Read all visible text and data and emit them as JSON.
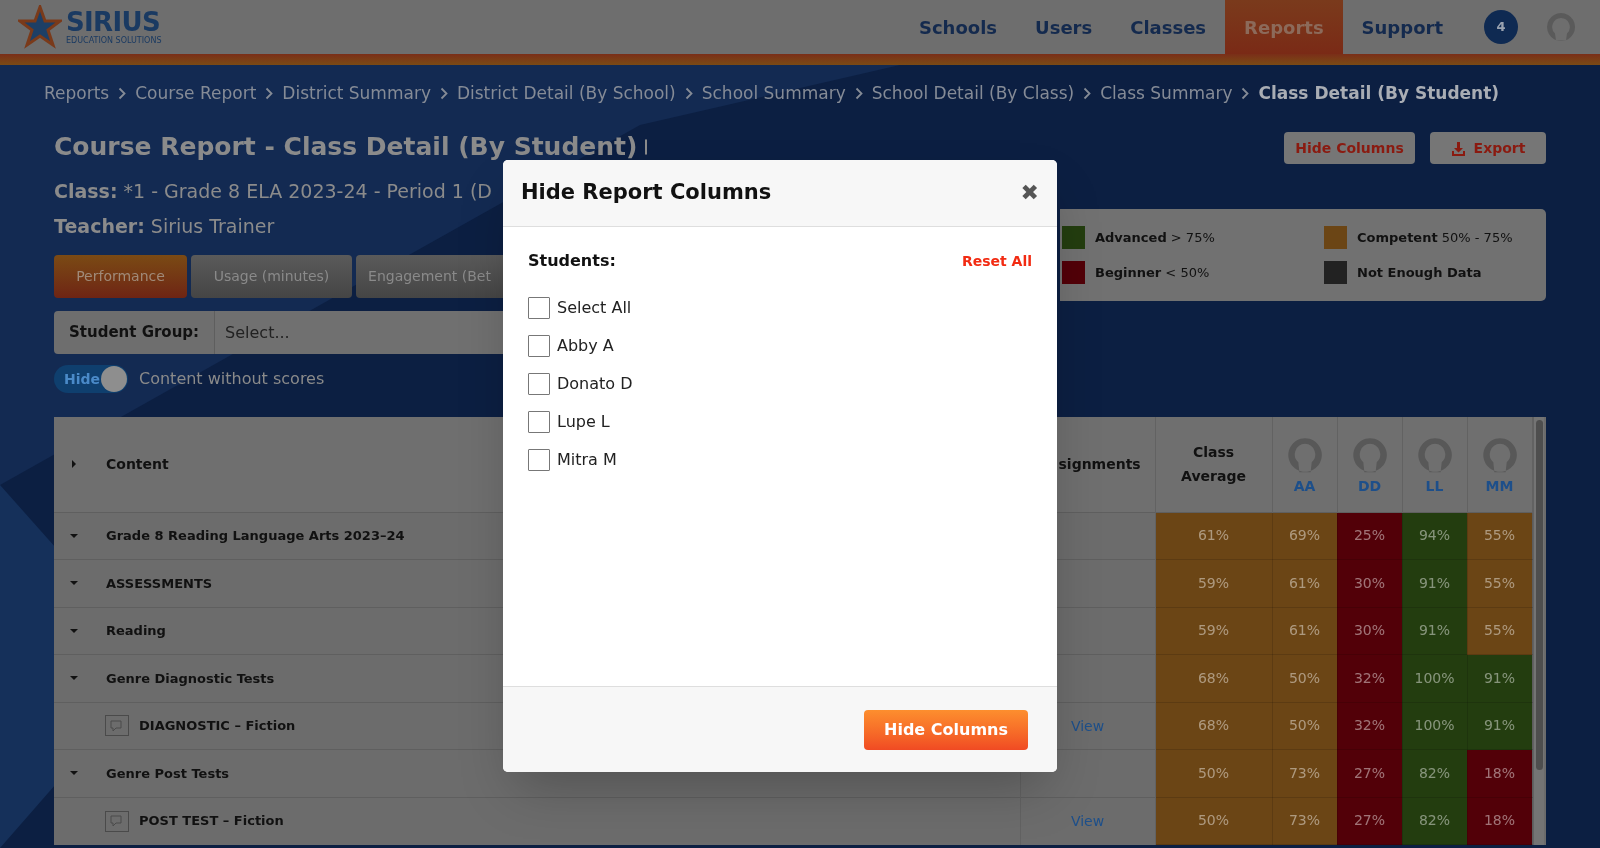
{
  "header": {
    "logo": {
      "name": "SIRIUS",
      "tagline": "EDUCATION SOLUTIONS"
    },
    "nav": [
      {
        "label": "Schools",
        "selected": false
      },
      {
        "label": "Users",
        "selected": false
      },
      {
        "label": "Classes",
        "selected": false
      },
      {
        "label": "Reports",
        "selected": true
      },
      {
        "label": "Support",
        "selected": false
      }
    ],
    "notification_count": "4"
  },
  "breadcrumb": [
    {
      "label": "Reports",
      "current": false
    },
    {
      "label": "Course Report",
      "current": false
    },
    {
      "label": "District Summary",
      "current": false
    },
    {
      "label": "District Detail (By School)",
      "current": false
    },
    {
      "label": "School Summary",
      "current": false
    },
    {
      "label": "School Detail (By Class)",
      "current": false
    },
    {
      "label": "Class Summary",
      "current": false
    },
    {
      "label": "Class Detail (By Student)",
      "current": true
    }
  ],
  "page": {
    "title": "Course Report - Class Detail (By Student)",
    "class_label": "Class:",
    "class_value": "*1 - Grade 8 ELA 2023-24 - Period 1 (D",
    "teacher_label": "Teacher:",
    "teacher_value": "Sirius Trainer"
  },
  "actions": [
    {
      "label": "Hide Columns",
      "kind": "plain"
    },
    {
      "label": "Export",
      "kind": "download"
    }
  ],
  "legend": [
    {
      "name": "Advanced",
      "range": "> 75%",
      "color": "#233d0f"
    },
    {
      "name": "Competent",
      "range": "50% - 75%",
      "color": "#6b4515"
    },
    {
      "name": "Beginner",
      "range": "< 50%",
      "color": "#520008"
    },
    {
      "name": "Not Enough Data",
      "color": "#222222"
    }
  ],
  "view_tabs": [
    {
      "label": "Performance",
      "selected": true
    },
    {
      "label": "Usage (minutes)",
      "selected": false
    },
    {
      "label": "Engagement (Bet",
      "selected": false
    }
  ],
  "student_group": {
    "label": "Student Group:",
    "value": "Select..."
  },
  "toggle": {
    "label": "Hide",
    "on": true,
    "caption": "Content without scores"
  },
  "table": {
    "columns": [
      "Content",
      "signments",
      "Class Average"
    ],
    "header_expanded": false,
    "students": [
      {
        "initials": "AA"
      },
      {
        "initials": "DD"
      },
      {
        "initials": "LL"
      },
      {
        "initials": "MM"
      }
    ],
    "rows": [
      {
        "kind": "group",
        "label": "Grade 8 Reading Language Arts 2023–24",
        "expanded": true,
        "class_average": {
          "text": "61%",
          "color": "#6b4515"
        },
        "scores": [
          {
            "text": "69%",
            "color": "#6b4515"
          },
          {
            "text": "25%",
            "color": "#520008"
          },
          {
            "text": "94%",
            "color": "#233d0f"
          },
          {
            "text": "55%",
            "color": "#6b4515"
          }
        ]
      },
      {
        "kind": "group",
        "label": "ASSESSMENTS",
        "expanded": true,
        "class_average": {
          "text": "59%",
          "color": "#6b4515"
        },
        "scores": [
          {
            "text": "61%",
            "color": "#6b4515"
          },
          {
            "text": "30%",
            "color": "#520008"
          },
          {
            "text": "91%",
            "color": "#233d0f"
          },
          {
            "text": "55%",
            "color": "#6b4515"
          }
        ]
      },
      {
        "kind": "group",
        "label": "Reading",
        "expanded": true,
        "class_average": {
          "text": "59%",
          "color": "#6b4515"
        },
        "scores": [
          {
            "text": "61%",
            "color": "#6b4515"
          },
          {
            "text": "30%",
            "color": "#520008"
          },
          {
            "text": "91%",
            "color": "#233d0f"
          },
          {
            "text": "55%",
            "color": "#6b4515"
          }
        ]
      },
      {
        "kind": "group",
        "label": "Genre Diagnostic Tests",
        "expanded": true,
        "class_average": {
          "text": "68%",
          "color": "#6b4515"
        },
        "scores": [
          {
            "text": "50%",
            "color": "#6b4515"
          },
          {
            "text": "32%",
            "color": "#520008"
          },
          {
            "text": "100%",
            "color": "#233d0f"
          },
          {
            "text": "91%",
            "color": "#233d0f"
          }
        ]
      },
      {
        "kind": "item",
        "label": "DIAGNOSTIC – Fiction",
        "assignment": "View",
        "class_average": {
          "text": "68%",
          "color": "#6b4515"
        },
        "scores": [
          {
            "text": "50%",
            "color": "#6b4515"
          },
          {
            "text": "32%",
            "color": "#520008"
          },
          {
            "text": "100%",
            "color": "#233d0f"
          },
          {
            "text": "91%",
            "color": "#233d0f"
          }
        ]
      },
      {
        "kind": "group",
        "label": "Genre Post Tests",
        "expanded": true,
        "class_average": {
          "text": "50%",
          "color": "#6b4515"
        },
        "scores": [
          {
            "text": "73%",
            "color": "#6b4515"
          },
          {
            "text": "27%",
            "color": "#520008"
          },
          {
            "text": "82%",
            "color": "#233d0f"
          },
          {
            "text": "18%",
            "color": "#520008"
          }
        ]
      },
      {
        "kind": "item",
        "label": "POST TEST – Fiction",
        "assignment": "View",
        "class_average": {
          "text": "50%",
          "color": "#6b4515"
        },
        "scores": [
          {
            "text": "73%",
            "color": "#6b4515"
          },
          {
            "text": "27%",
            "color": "#520008"
          },
          {
            "text": "82%",
            "color": "#233d0f"
          },
          {
            "text": "18%",
            "color": "#520008"
          }
        ]
      }
    ]
  },
  "modal": {
    "title": "Hide Report Columns",
    "close": "✖",
    "section_label": "Students:",
    "reset": "Reset All",
    "options": [
      {
        "label": "Select All",
        "checked": false
      },
      {
        "label": "Abby A",
        "checked": false
      },
      {
        "label": "Donato D",
        "checked": false
      },
      {
        "label": "Lupe L",
        "checked": false
      },
      {
        "label": "Mitra M",
        "checked": false
      }
    ],
    "submit": "Hide Columns"
  }
}
